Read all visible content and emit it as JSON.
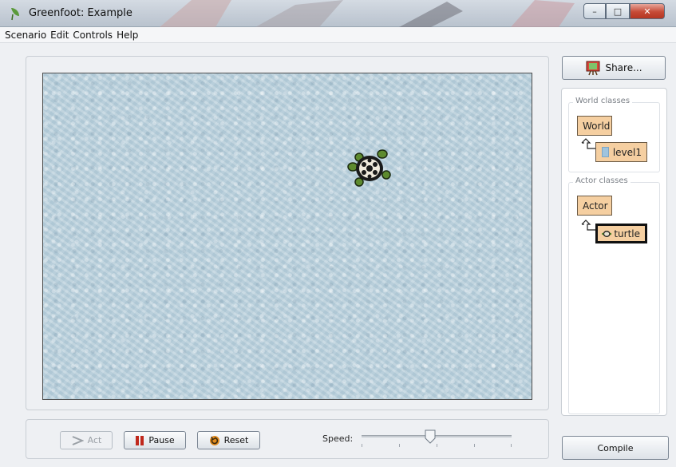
{
  "window": {
    "title": "Greenfoot: Example",
    "min_glyph": "–",
    "max_glyph": "□",
    "close_glyph": "✕"
  },
  "menu": [
    "Scenario",
    "Edit",
    "Controls",
    "Help"
  ],
  "controls": {
    "act_label": "Act",
    "pause_label": "Pause",
    "reset_label": "Reset",
    "speed_label": "Speed:",
    "speed_fraction": 0.46
  },
  "sidebar": {
    "share_label": "Share...",
    "world_classes_title": "World classes",
    "world_class": "World",
    "world_subclass": "level1",
    "actor_classes_title": "Actor classes",
    "actor_class": "Actor",
    "actor_subclass": "turtle",
    "compile_label": "Compile"
  },
  "colors": {
    "class_fill": "#f5cfa1",
    "pause_red": "#c0281c",
    "world_water": "#b7ceda"
  },
  "icons": {
    "app": "greenfoot-leaf-icon",
    "act": "play-arrow-icon",
    "pause": "pause-icon",
    "reset": "reset-icon",
    "share": "share-easel-icon",
    "turtle": "turtle-icon"
  }
}
